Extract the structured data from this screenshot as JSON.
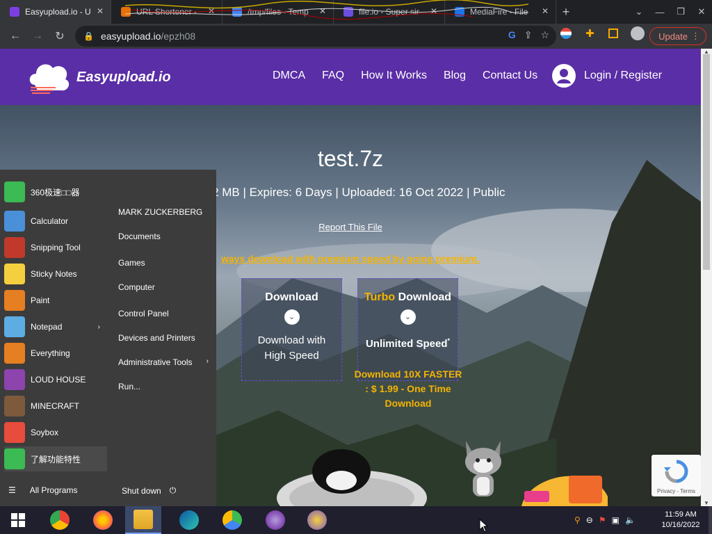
{
  "browser": {
    "tabs": [
      {
        "label": "Easyupload.io - U",
        "active": true,
        "favicon_color": "#7b3fe4"
      },
      {
        "label": "URL Shortener -",
        "active": false,
        "favicon_color": "#e8710a"
      },
      {
        "label": "/tmp/files - Temp",
        "active": false,
        "favicon_color": "#4285f4"
      },
      {
        "label": "file.io - Super sir",
        "active": false,
        "favicon_color": "#6c4ee0"
      },
      {
        "label": "MediaFire - File",
        "active": false,
        "favicon_color": "#1a73e8"
      }
    ],
    "url_host": "easyupload.io",
    "url_path": "/epzh08",
    "update_label": "Update"
  },
  "site": {
    "logo_text": "Easyupload.io",
    "nav": [
      "DMCA",
      "FAQ",
      "How It Works",
      "Blog",
      "Contact Us"
    ],
    "login_label": "Login / Register",
    "file_title": "test.7z",
    "file_meta": "4.12 MB | Expires: 6 Days | Uploaded: 16 Oct 2022 | Public",
    "report_label": "Report This File",
    "premium_line": "ways download with premium speed by going premium.",
    "download_box": {
      "title": "Download",
      "sub_line1": "Download with",
      "sub_line2": "High Speed"
    },
    "turbo_box": {
      "title_turbo": "Turbo",
      "title_rest": "Download",
      "sub": "Unlimited Speed",
      "sup": "*"
    },
    "turbo_price": {
      "line1": "Download 10X FASTER",
      "line2": ": $ 1.99 - One Time",
      "line3": "Download"
    },
    "recaptcha_text": "Privacy - Terms"
  },
  "startmenu": {
    "left_items": [
      {
        "label": "360极速□□器",
        "icon": "360-browser-icon",
        "color": "#3cba54"
      },
      {
        "label": "Calculator",
        "icon": "calculator-icon",
        "color": "#4a90d9"
      },
      {
        "label": "Snipping Tool",
        "icon": "snipping-tool-icon",
        "color": "#c0392b"
      },
      {
        "label": "Sticky Notes",
        "icon": "sticky-notes-icon",
        "color": "#f4d03f"
      },
      {
        "label": "Paint",
        "icon": "paint-icon",
        "color": "#e67e22"
      },
      {
        "label": "Notepad",
        "icon": "notepad-icon",
        "color": "#5dade2",
        "submenu": true
      },
      {
        "label": "Everything",
        "icon": "everything-search-icon",
        "color": "#e67e22"
      },
      {
        "label": "LOUD HOUSE",
        "icon": "loud-house-icon",
        "color": "#8e44ad"
      },
      {
        "label": "MINECRAFT",
        "icon": "minecraft-icon",
        "color": "#7d5a3c"
      },
      {
        "label": "Soybox",
        "icon": "soybox-icon",
        "color": "#e74c3c"
      },
      {
        "label": "了解功能特性",
        "icon": "features-icon",
        "color": "#3cba54"
      }
    ],
    "right_items": [
      {
        "label": "MARK ZUCKERBERG"
      },
      {
        "label": "Documents"
      },
      {
        "label": "Games"
      },
      {
        "label": "Computer"
      },
      {
        "label": "Control Panel"
      },
      {
        "label": "Devices and Printers"
      },
      {
        "label": "Administrative Tools",
        "submenu": true
      },
      {
        "label": "Run..."
      }
    ],
    "all_programs": "All Programs",
    "shutdown": "Shut down"
  },
  "taskbar": {
    "apps": [
      {
        "name": "chrome-icon",
        "active": false
      },
      {
        "name": "firefox-icon",
        "active": false
      },
      {
        "name": "file-explorer-icon",
        "active": true
      },
      {
        "name": "edge-icon",
        "active": false
      },
      {
        "name": "360-browser-icon",
        "active": false
      },
      {
        "name": "bonzi-buddy-icon",
        "active": false
      },
      {
        "name": "yahoo-messenger-icon",
        "active": false
      }
    ],
    "time": "11:59 AM",
    "date": "10/16/2022"
  }
}
